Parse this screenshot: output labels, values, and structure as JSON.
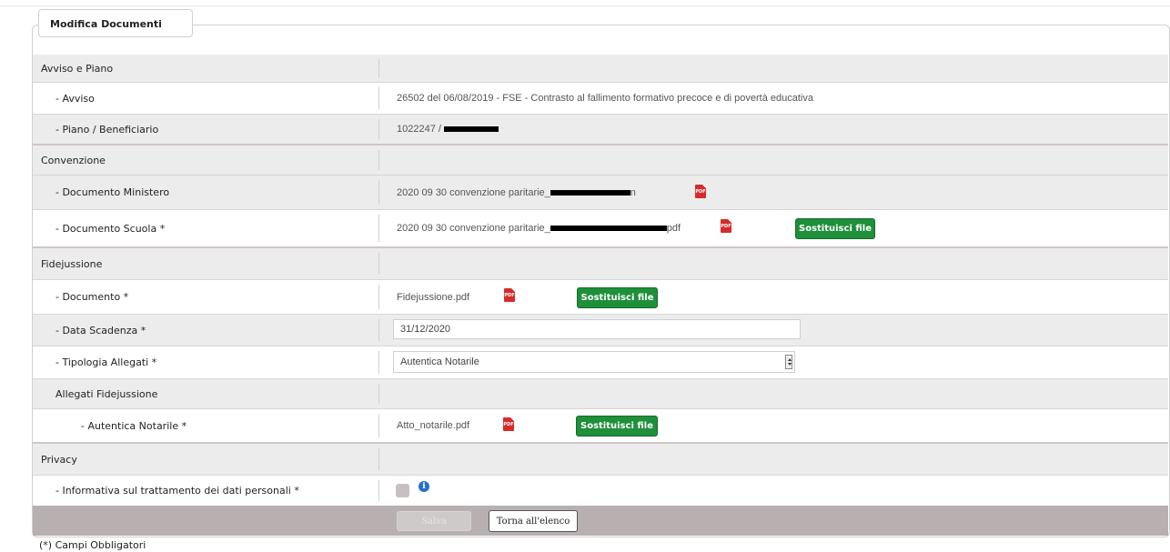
{
  "form_title": "Modifica Documenti",
  "sections": {
    "avviso_piano": {
      "title": "Avviso e Piano",
      "avviso_label": "- Avviso",
      "avviso_value": "26502 del 06/08/2019 - FSE - Contrasto al fallimento formativo precoce e di povertà educativa",
      "piano_label": "- Piano / Beneficiario",
      "piano_value": "1022247 /"
    },
    "convenzione": {
      "title": "Convenzione",
      "doc_ministero_label": "- Documento Ministero",
      "doc_ministero_file": "2020 09 30 convenzione paritarie_",
      "doc_ministero_file_end": "n",
      "doc_scuola_label": "- Documento Scuola *",
      "doc_scuola_file": "2020 09 30 convenzione paritarie_",
      "doc_scuola_file_end": "pdf"
    },
    "fidejussione": {
      "title": "Fidejussione",
      "documento_label": "- Documento *",
      "documento_file": "Fidejussione.pdf",
      "data_scadenza_label": "- Data Scadenza *",
      "data_scadenza_value": "31/12/2020",
      "tipologia_label": "- Tipologia Allegati *",
      "tipologia_value": "Autentica Notarile",
      "allegati_title": "Allegati Fidejussione",
      "autentica_label": "- Autentica Notarile *",
      "autentica_file": "Atto_notarile.pdf"
    },
    "privacy": {
      "title": "Privacy",
      "informativa_label": "- Informativa sul trattamento dei dati personali *"
    }
  },
  "pdf_icon_text": "PDF",
  "replace_button_label": "Sostituisci file",
  "info_icon_text": "i",
  "actions": {
    "save_label": "Salva",
    "back_label": "Torna all'elenco"
  },
  "required_note": "(*) Campi Obbligatori",
  "colors": {
    "green_button": "#1e8f3a",
    "pdf_red": "#d62b2b",
    "info_blue": "#2b6fc4",
    "footer_bar": "#b8b0b0"
  }
}
